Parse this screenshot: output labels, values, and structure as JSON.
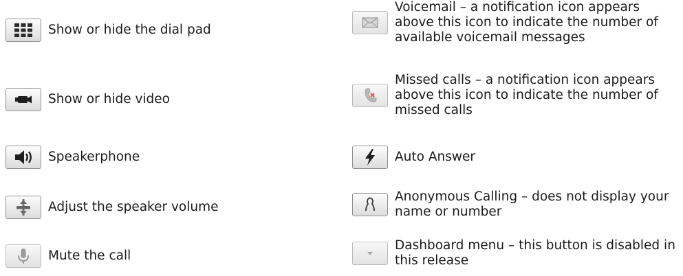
{
  "left_items": [
    {
      "icon": "dialpad-icon",
      "label": "Show or hide the dial pad"
    },
    {
      "icon": "video-camera-icon",
      "label": "Show or hide video"
    },
    {
      "icon": "speaker-icon",
      "label": "Speakerphone"
    },
    {
      "icon": "volume-adjust-icon",
      "label": "Adjust the speaker volume"
    },
    {
      "icon": "microphone-icon",
      "label": "Mute the call"
    }
  ],
  "right_items": [
    {
      "icon": "envelope-icon",
      "label": "Voicemail – a notification icon appears above this icon to indicate the number of available voicemail messages"
    },
    {
      "icon": "missed-call-icon",
      "label": "Missed calls – a notification icon appears above this icon to indicate the number of missed calls"
    },
    {
      "icon": "lightning-icon",
      "label": "Auto Answer"
    },
    {
      "icon": "anonymous-icon",
      "label": "Anonymous Calling – does not display your name or number"
    },
    {
      "icon": "dropdown-arrow-icon",
      "label": "Dashboard menu – this button is disabled in this release"
    }
  ]
}
